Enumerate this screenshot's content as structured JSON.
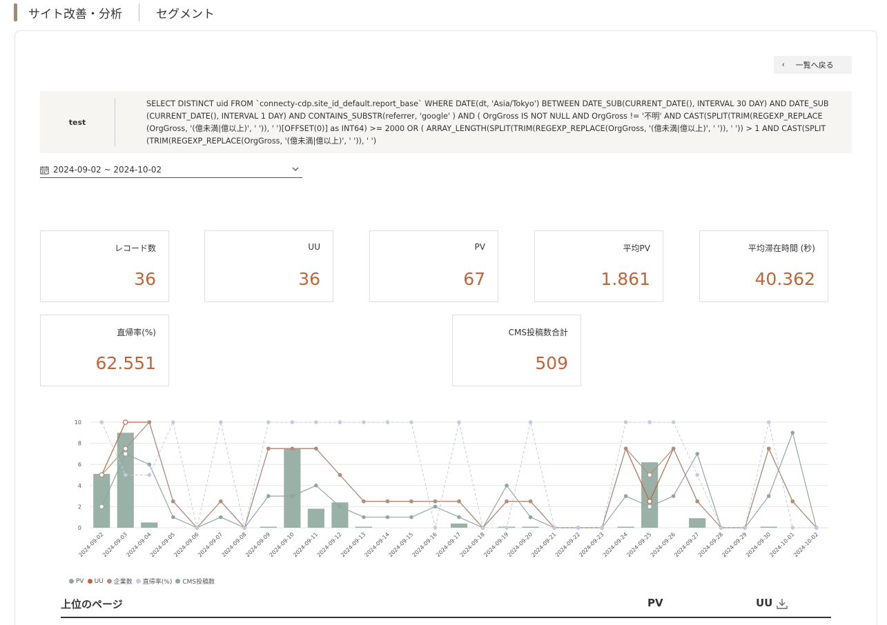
{
  "header": {
    "title": "サイト改善・分析",
    "subtitle": "セグメント"
  },
  "back_button": {
    "label": "一覧へ戻る"
  },
  "query": {
    "name": "test",
    "sql": "SELECT DISTINCT uid FROM `connecty-cdp.site_id_default.report_base` WHERE DATE(dt, 'Asia/Tokyo') BETWEEN DATE_SUB(CURRENT_DATE(), INTERVAL 30 DAY) AND DATE_SUB(CURRENT_DATE(), INTERVAL 1 DAY) AND CONTAINS_SUBSTR(referrer, 'google' ) AND ( OrgGross IS NOT NULL AND OrgGross != '不明' AND CAST(SPLIT(TRIM(REGEXP_REPLACE(OrgGross, '(億未満|億以上)', ' ')), ' ')[OFFSET(0)] as INT64) >= 2000 OR ( ARRAY_LENGTH(SPLIT(TRIM(REGEXP_REPLACE(OrgGross, '(億未満|億以上)', ' ')), ' ')) > 1 AND CAST(SPLIT(TRIM(REGEXP_REPLACE(OrgGross, '(億未満|億以上)', ' ')), ' ')"
  },
  "date_range": {
    "value": "2024-09-02 ~ 2024-10-02"
  },
  "metrics": [
    {
      "label": "レコード数",
      "value": "36"
    },
    {
      "label": "UU",
      "value": "36"
    },
    {
      "label": "PV",
      "value": "67"
    },
    {
      "label": "平均PV",
      "value": "1.861"
    },
    {
      "label": "平均滞在時間 (秒)",
      "value": "40.362"
    },
    {
      "label": "直帰率(%)",
      "value": "62.551"
    },
    {
      "label": "CMS投稿数合計",
      "value": "509"
    }
  ],
  "chart_data": {
    "type": "bar",
    "categories": [
      "2024-09-02",
      "2024-09-03",
      "2024-09-04",
      "2024-09-05",
      "2024-09-06",
      "2024-09-07",
      "2024-09-08",
      "2024-09-09",
      "2024-09-10",
      "2024-09-11",
      "2024-09-12",
      "2024-09-13",
      "2024-09-14",
      "2024-09-15",
      "2024-09-16",
      "2024-09-17",
      "2024-09-18",
      "2024-09-19",
      "2024-09-20",
      "2024-09-21",
      "2024-09-22",
      "2024-09-23",
      "2024-09-24",
      "2024-09-25",
      "2024-09-26",
      "2024-09-27",
      "2024-09-28",
      "2024-09-29",
      "2024-09-30",
      "2024-10-01",
      "2024-10-02"
    ],
    "y_ticks": [
      "0",
      "2",
      "4",
      "6",
      "8",
      "10"
    ],
    "ylim": [
      0,
      10
    ],
    "grid": true,
    "legend_position": "bottom-left",
    "series": [
      {
        "name": "PV",
        "render": "line",
        "color": "#8fa89f",
        "values": [
          2,
          7,
          6,
          1,
          0,
          1,
          0,
          3,
          3,
          4,
          2,
          1,
          1,
          1,
          2,
          1,
          0,
          4,
          1,
          0,
          0,
          0,
          3,
          2,
          3,
          7,
          0,
          0,
          3,
          9,
          0
        ]
      },
      {
        "name": "UU",
        "render": "line",
        "color": "#c0643a",
        "values": [
          5,
          10,
          10,
          2.5,
          0,
          2.5,
          0,
          7.5,
          7.5,
          7.5,
          5,
          2.5,
          2.5,
          2.5,
          2.5,
          2.5,
          0,
          2.5,
          2.5,
          0,
          0,
          0,
          7.5,
          2.5,
          7.5,
          2.5,
          0,
          0,
          7.5,
          2.5,
          0
        ]
      },
      {
        "name": "企業数",
        "render": "line",
        "color": "#b08f7f",
        "values": [
          5,
          7.5,
          10,
          2.5,
          0,
          2.5,
          0,
          7.5,
          7.5,
          7.5,
          5,
          2.5,
          2.5,
          2.5,
          2.5,
          2.5,
          0,
          2.5,
          2.5,
          0,
          0,
          0,
          7.5,
          5,
          7.5,
          2.5,
          0,
          0,
          7.5,
          2.5,
          0
        ]
      },
      {
        "name": "直帰率(%)",
        "render": "dashed",
        "color": "#c3c9e8",
        "values": [
          10,
          5,
          5,
          10,
          0,
          10,
          0,
          10,
          10,
          10,
          10,
          10,
          10,
          10,
          0,
          10,
          0,
          0,
          10,
          0,
          0,
          0,
          10,
          10,
          10,
          5,
          0,
          0,
          10,
          0,
          0
        ]
      },
      {
        "name": "CMS投稿数",
        "render": "bar",
        "color": "#8fa89f",
        "values": [
          5.1,
          9,
          0.5,
          0,
          0,
          0,
          0,
          0.1,
          7.5,
          1.8,
          2.4,
          0.1,
          0,
          0,
          0,
          0.4,
          0,
          0.1,
          0.1,
          0,
          0,
          0,
          0.1,
          6.2,
          0,
          0.9,
          0,
          0,
          0.1,
          0,
          0
        ]
      }
    ]
  },
  "table": {
    "columns": [
      "上位のページ",
      "PV",
      "UU"
    ]
  },
  "icons": {
    "back": "chevron-left-icon",
    "calendar": "calendar-icon",
    "dropdown": "chevron-down-icon",
    "download": "download-icon"
  }
}
